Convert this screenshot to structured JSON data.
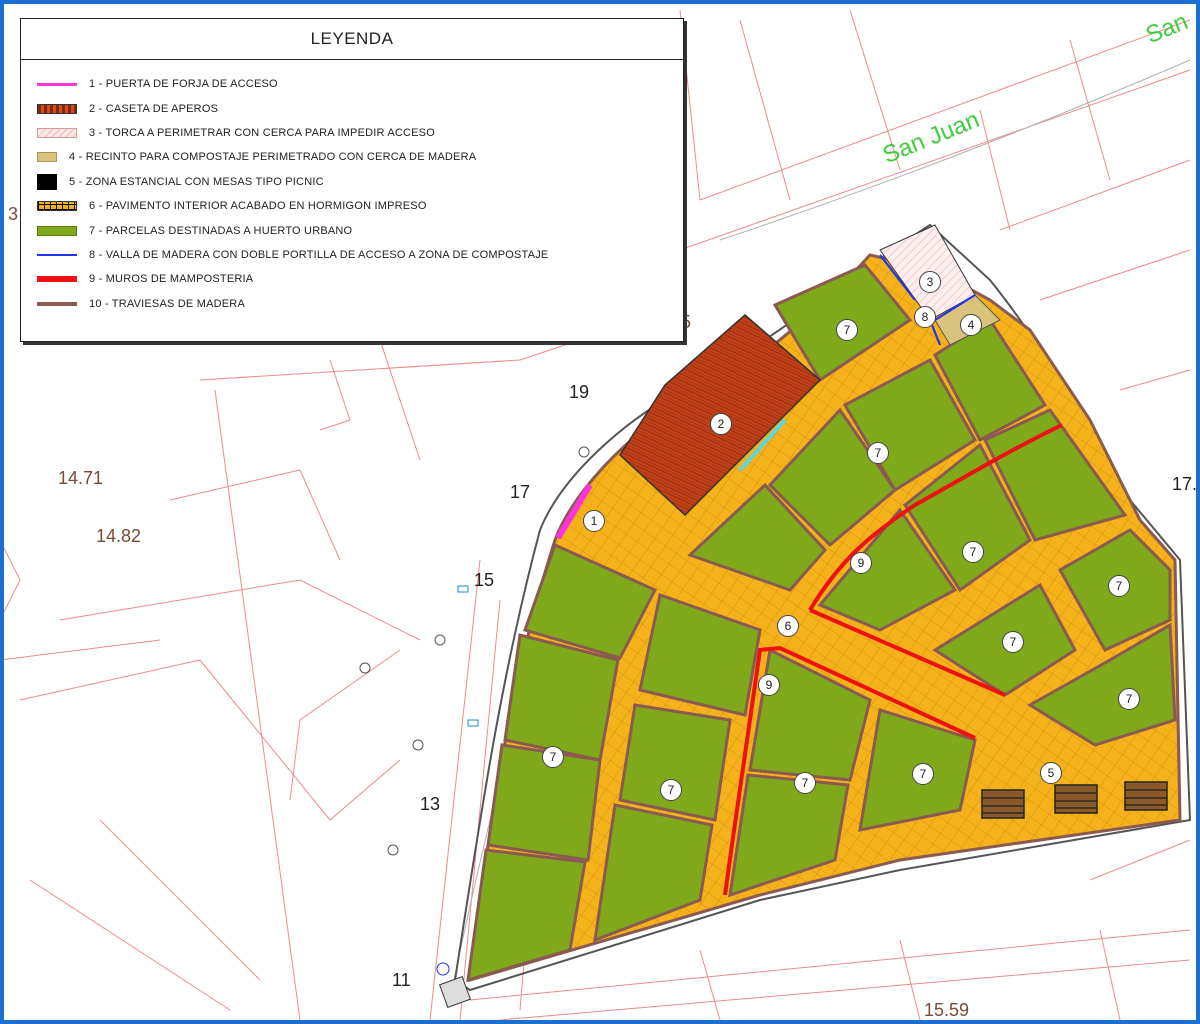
{
  "legend": {
    "title": "LEYENDA",
    "items": [
      {
        "label": "1 - PUERTA DE FORJA DE ACCESO",
        "swatch": "line-magenta"
      },
      {
        "label": "2 - CASETA DE APEROS",
        "swatch": "caseta"
      },
      {
        "label": "3 - TORCA A PERIMETRAR CON CERCA PARA IMPEDIR ACCESO",
        "swatch": "torca"
      },
      {
        "label": "4 - RECINTO PARA COMPOSTAJE PERIMETRADO CON CERCA DE MADERA",
        "swatch": "compost"
      },
      {
        "label": "5 - ZONA ESTANCIAL CON MESAS TIPO PICNIC",
        "swatch": "picnic"
      },
      {
        "label": "6 - PAVIMENTO INTERIOR ACABADO EN HORMIGON IMPRESO",
        "swatch": "pavimento"
      },
      {
        "label": "7 - PARCELAS DESTINADAS A HUERTO URBANO",
        "swatch": "huerto"
      },
      {
        "label": "8 - VALLA DE MADERA CON DOBLE PORTILLA DE ACCESO A ZONA DE COMPOSTAJE",
        "swatch": "line-blue"
      },
      {
        "label": "9 - MUROS DE MAMPOSTERIA",
        "swatch": "muro"
      },
      {
        "label": "10 - TRAVIESAS DE MADERA",
        "swatch": "traviesa"
      }
    ]
  },
  "map": {
    "street_labels": [
      "San Juan",
      "San"
    ],
    "house_numbers": [
      "19",
      "17",
      "15",
      "13",
      "11"
    ],
    "elevations": [
      "14.71",
      "14.82",
      "15.59"
    ],
    "edge_fragments": [
      "17.",
      "3",
      "5"
    ],
    "markers": [
      "1",
      "2",
      "3",
      "4",
      "5",
      "6",
      "7",
      "8",
      "9"
    ]
  },
  "colors": {
    "frame": "#1a6fcf",
    "huerto": "#7fa81a",
    "pavimento": "#f5b21a",
    "caseta": "#c2401a",
    "muro": "#ee1111",
    "traviesa": "#8a5a50",
    "puerta": "#ff33dd",
    "valla": "#2233ee",
    "cadastre_line": "#f08a8a",
    "street_label": "#3fcc3f"
  }
}
